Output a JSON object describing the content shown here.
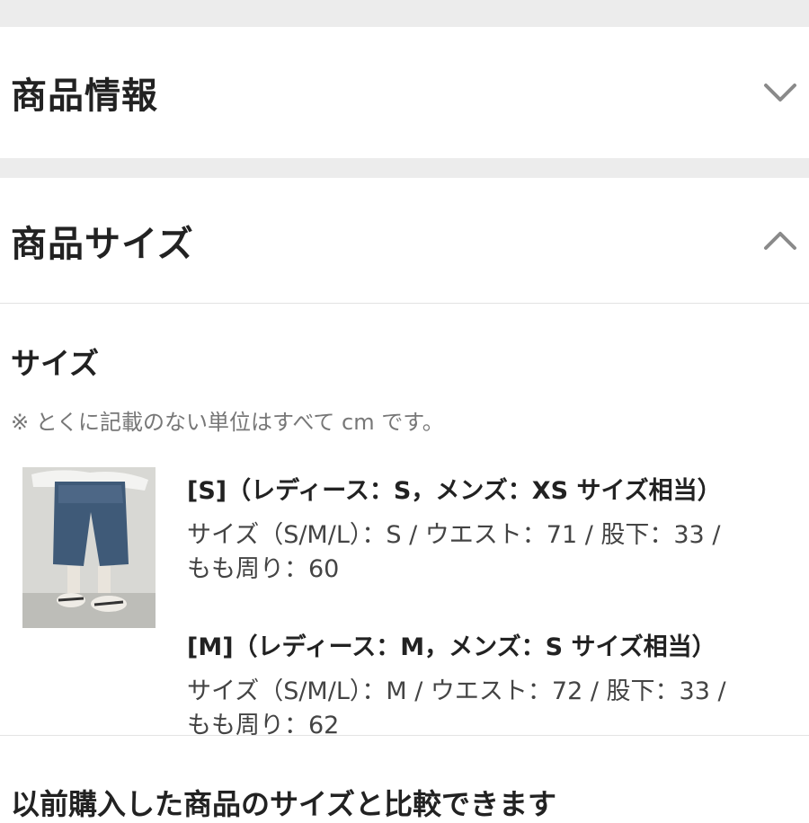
{
  "sections": {
    "product_info": {
      "title": "商品情報",
      "expanded": false
    },
    "product_size": {
      "title": "商品サイズ",
      "expanded": true
    }
  },
  "size_panel": {
    "heading": "サイズ",
    "note": "※ とくに記載のない単位はすべて cm です。",
    "entries": [
      {
        "title": "[S]（レディース：S，メンズ：XS サイズ相当）",
        "detail_line1": "サイズ（S/M/L）：S / ウエスト：71 / 股下：33 /",
        "detail_line2": "もも周り：60"
      },
      {
        "title": "[M]（レディース：M，メンズ：S サイズ相当）",
        "detail_line1": "サイズ（S/M/L）：M / ウエスト：72 / 股下：33 /",
        "detail_line2": "もも周り：62"
      }
    ]
  },
  "compare": {
    "title": "以前購入した商品のサイズと比較できます"
  },
  "icons": {
    "product_info_toggle": "chevron-down-icon",
    "product_size_toggle": "chevron-up-icon"
  },
  "colors": {
    "band": "#ececec",
    "text": "#222222",
    "muted": "#777777",
    "chevron": "#8a8a8a"
  }
}
